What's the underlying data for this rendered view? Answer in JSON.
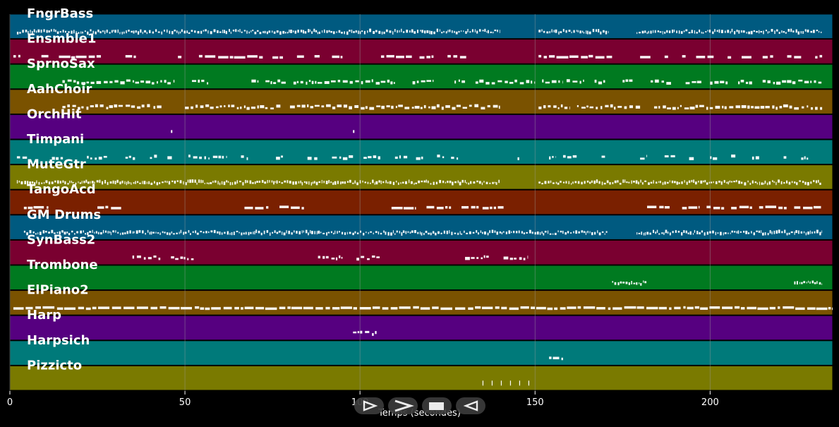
{
  "xlabel": "Temps (secondes)",
  "xlim": [
    0,
    235
  ],
  "ticks": [
    0,
    50,
    100,
    150,
    200
  ],
  "note_color": "#ffffff",
  "grid_color": "#9a9a9a",
  "tracks": [
    {
      "name": "FngrBass",
      "color": "#005a80",
      "style": "dense",
      "segments": [
        [
          2,
          140
        ],
        [
          151,
          171
        ],
        [
          179,
          232
        ]
      ]
    },
    {
      "name": "Ensmble1",
      "color": "#7a0030",
      "style": "blocks",
      "segments": [
        [
          1,
          3
        ],
        [
          9,
          11
        ],
        [
          14,
          26
        ],
        [
          33,
          36
        ],
        [
          48,
          49
        ],
        [
          54,
          73
        ],
        [
          75,
          78
        ],
        [
          82,
          84
        ],
        [
          87,
          89
        ],
        [
          92,
          95
        ],
        [
          106,
          115
        ],
        [
          117,
          121
        ],
        [
          125,
          131
        ],
        [
          151,
          172
        ],
        [
          180,
          183
        ],
        [
          187,
          188
        ],
        [
          192,
          193
        ],
        [
          196,
          201
        ],
        [
          205,
          206
        ],
        [
          209,
          212
        ],
        [
          215,
          218
        ],
        [
          222,
          226
        ],
        [
          230,
          232
        ]
      ]
    },
    {
      "name": "SprnoSax",
      "color": "#007a20",
      "style": "sparse",
      "segments": [
        [
          15,
          47
        ],
        [
          52,
          57
        ],
        [
          69,
          71
        ],
        [
          73,
          79
        ],
        [
          81,
          110
        ],
        [
          115,
          121
        ],
        [
          127,
          130
        ],
        [
          133,
          150
        ],
        [
          152,
          158
        ],
        [
          159,
          164
        ],
        [
          167,
          170
        ],
        [
          175,
          178
        ],
        [
          183,
          189
        ],
        [
          193,
          198
        ],
        [
          200,
          205
        ],
        [
          208,
          212
        ],
        [
          215,
          232
        ]
      ]
    },
    {
      "name": "AahChoir",
      "color": "#7a5200",
      "style": "sparse",
      "segments": [
        [
          15,
          40
        ],
        [
          41,
          44
        ],
        [
          50,
          78
        ],
        [
          80,
          140
        ],
        [
          151,
          160
        ],
        [
          162,
          180
        ],
        [
          184,
          232
        ]
      ]
    },
    {
      "name": "OrchHit",
      "color": "#560080",
      "style": "hits",
      "segments": [
        [
          46,
          46.4
        ],
        [
          98,
          98.6
        ]
      ]
    },
    {
      "name": "Timpani",
      "color": "#007a7a",
      "style": "sparse",
      "segments": [
        [
          2,
          5
        ],
        [
          12,
          16
        ],
        [
          22,
          28
        ],
        [
          33,
          36
        ],
        [
          40,
          42
        ],
        [
          45,
          47
        ],
        [
          51,
          57
        ],
        [
          58,
          62
        ],
        [
          66,
          68
        ],
        [
          76,
          78
        ],
        [
          85,
          88
        ],
        [
          92,
          98
        ],
        [
          101,
          106
        ],
        [
          110,
          114
        ],
        [
          116,
          118
        ],
        [
          122,
          124
        ],
        [
          126,
          128
        ],
        [
          145,
          146
        ],
        [
          154,
          156
        ],
        [
          158,
          162
        ],
        [
          169,
          170
        ],
        [
          180,
          182
        ],
        [
          187,
          190
        ],
        [
          194,
          196
        ],
        [
          200,
          202
        ],
        [
          206,
          208
        ],
        [
          212,
          214
        ],
        [
          221,
          222
        ],
        [
          226,
          228
        ]
      ]
    },
    {
      "name": "MuteGtr",
      "color": "#7a7a00",
      "style": "dense",
      "segments": [
        [
          2,
          140
        ],
        [
          151,
          232
        ]
      ]
    },
    {
      "name": "TangoAcd",
      "color": "#7a2000",
      "style": "blocks",
      "segments": [
        [
          4,
          11
        ],
        [
          25,
          32
        ],
        [
          67,
          74
        ],
        [
          77,
          84
        ],
        [
          109,
          116
        ],
        [
          119,
          126
        ],
        [
          129,
          134
        ],
        [
          135,
          141
        ],
        [
          182,
          189
        ],
        [
          192,
          197
        ],
        [
          199,
          204
        ],
        [
          206,
          212
        ],
        [
          214,
          222
        ],
        [
          224,
          232
        ]
      ]
    },
    {
      "name": "GM Drums",
      "color": "#005a80",
      "style": "dense",
      "segments": [
        [
          4,
          171
        ],
        [
          179,
          232
        ]
      ]
    },
    {
      "name": "SynBass2",
      "color": "#7a0030",
      "style": "sparse",
      "segments": [
        [
          35,
          43
        ],
        [
          46,
          53
        ],
        [
          88,
          95
        ],
        [
          99,
          106
        ],
        [
          130,
          137
        ],
        [
          141,
          148
        ]
      ]
    },
    {
      "name": "Trombone",
      "color": "#007a20",
      "style": "dense",
      "segments": [
        [
          172,
          182
        ],
        [
          224,
          232
        ]
      ]
    },
    {
      "name": "ElPiano2",
      "color": "#7a5200",
      "style": "blocks",
      "segments": [
        [
          1,
          235
        ]
      ]
    },
    {
      "name": "Harp",
      "color": "#560080",
      "style": "sparse",
      "segments": [
        [
          98,
          105
        ]
      ]
    },
    {
      "name": "Harpsich",
      "color": "#007a7a",
      "style": "blocks",
      "segments": [
        [
          154,
          158
        ]
      ]
    },
    {
      "name": "Pizzicto",
      "color": "#7a7a00",
      "style": "ticks",
      "segments": [
        [
          135,
          149
        ]
      ]
    }
  ],
  "controls": [
    {
      "name": "step-forward-button",
      "icon": "step-forward-icon"
    },
    {
      "name": "forward-button",
      "icon": "forward-icon"
    },
    {
      "name": "stop-button",
      "icon": "stop-icon"
    },
    {
      "name": "rewind-button",
      "icon": "rewind-icon"
    }
  ]
}
